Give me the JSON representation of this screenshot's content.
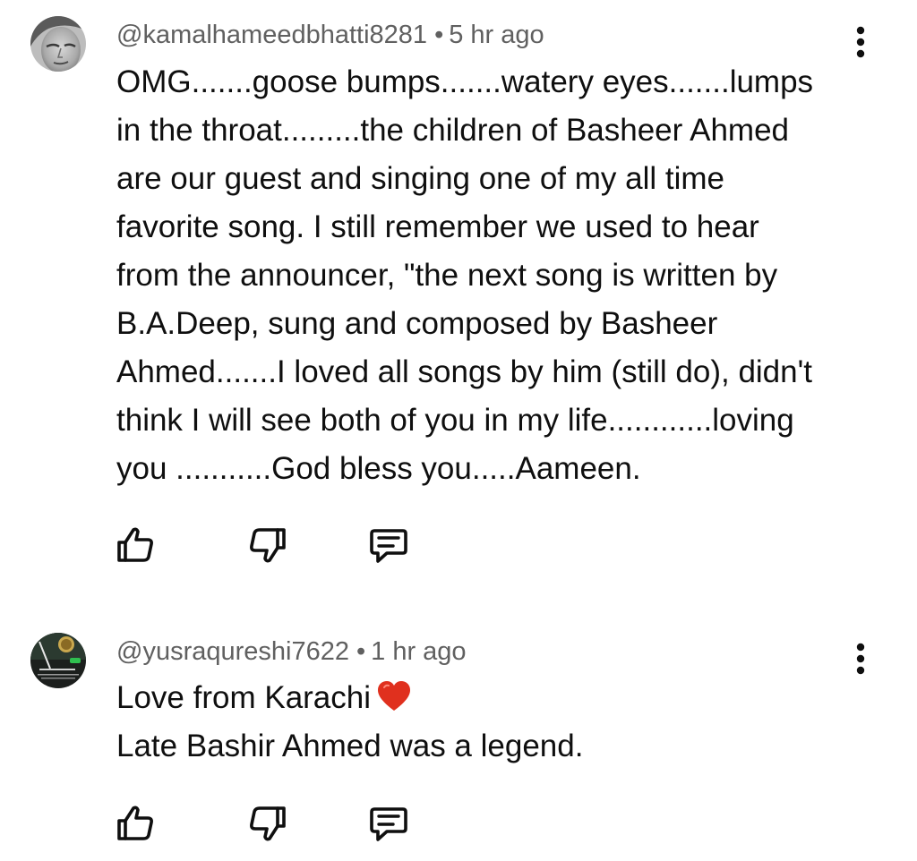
{
  "comments": [
    {
      "handle": "@kamalhameedbhatti8281",
      "separator": "•",
      "time": "5 hr ago",
      "lines": [
        "OMG.......goose bumps.......watery eyes.......lumps",
        "in the throat.........the children of Basheer Ahmed",
        "are our guest and singing one of my all time",
        "favorite song. I still remember we used to hear",
        "from the announcer, \"the next song is written by",
        "B.A.Deep, sung and composed by Basheer",
        "Ahmed.......I loved all songs by him (still do), didn't",
        "think I will see both of you in my life............loving",
        "you ...........God bless you.....Aameen."
      ],
      "icons": {
        "avatar": "grayscale-face-avatar",
        "menu": "more-vert-icon",
        "like": "thumb-up-icon",
        "dislike": "thumb-down-icon",
        "reply": "reply-comment-icon"
      }
    },
    {
      "handle": "@yusraqureshi7622",
      "separator": "•",
      "time": "1 hr ago",
      "lines": [
        "Love from Karachi",
        "Late Bashir Ahmed was a legend."
      ],
      "emoji": "red-heart-emoji",
      "icons": {
        "avatar": "dark-poster-avatar",
        "menu": "more-vert-icon",
        "like": "thumb-up-icon",
        "dislike": "thumb-down-icon",
        "reply": "reply-comment-icon"
      }
    }
  ],
  "colors": {
    "text": "#0f0f0f",
    "meta": "#606060",
    "icon": "#0f0f0f",
    "heart": "#e0301e"
  }
}
